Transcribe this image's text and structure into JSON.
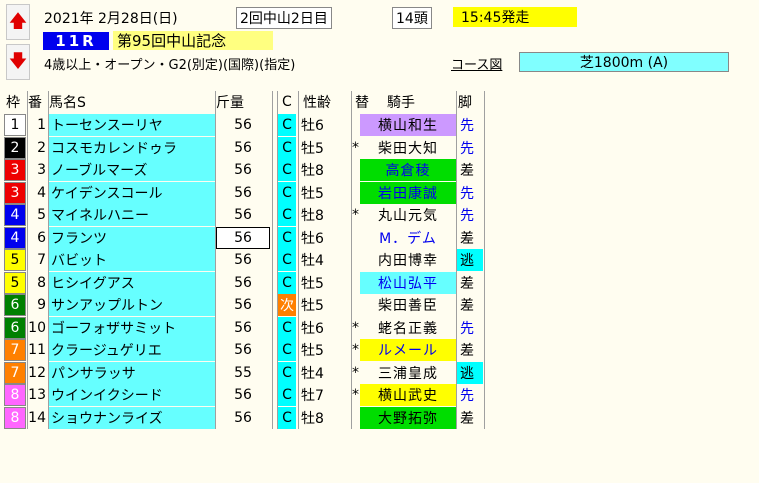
{
  "header": {
    "date": "2021年",
    "month_day": "2月28日(日)",
    "meeting": "2回中山2日目",
    "runners": "14頭",
    "post_time": "15:45発走",
    "race_no": "11R",
    "race_name": "第95回中山記念",
    "conditions": "4歳以上・オープン・G2(別定)(国際)(指定)",
    "course_link": "コース図",
    "course": "芝1800m (A)",
    "up_arrow": "🡅",
    "down_arrow": "🡇"
  },
  "columns": [
    "枠",
    "番",
    "馬名S",
    "斤量",
    "C",
    "性齢",
    "替",
    "騎手",
    "脚"
  ],
  "colors": {
    "frame": {
      "1": [
        "#ffffff",
        "#000000"
      ],
      "2": [
        "#000000",
        "#ffffff"
      ],
      "3": [
        "#ee0000",
        "#ffffff"
      ],
      "4": [
        "#0000ee",
        "#ffffff"
      ],
      "5": [
        "#ffff00",
        "#000000"
      ],
      "6": [
        "#008000",
        "#ffffff"
      ],
      "7": [
        "#ff8000",
        "#ffffff"
      ],
      "8": [
        "#ff66ff",
        "#ffffff"
      ]
    },
    "horse_cell": "#66ffff",
    "c_cell": "#00ffff",
    "next_cell": "#ff8000",
    "style_cell": "#66ffff"
  },
  "horses": [
    {
      "frame": "1",
      "num": "1",
      "name": "トーセンスーリヤ",
      "weight": "56",
      "c": "C",
      "sex_age": "牡6",
      "change": "",
      "jockey": "横山和生",
      "jockey_bg": "#cc99ff",
      "jockey_color": "#000000",
      "style": "先",
      "style_bg": "",
      "style_color": "#0000ee"
    },
    {
      "frame": "2",
      "num": "2",
      "name": "コスモカレンドゥラ",
      "weight": "56",
      "c": "C",
      "sex_age": "牡5",
      "change": "*",
      "jockey": "柴田大知",
      "jockey_bg": "",
      "jockey_color": "#000000",
      "style": "先",
      "style_bg": "",
      "style_color": "#0000ee"
    },
    {
      "frame": "3",
      "num": "3",
      "name": "ノーブルマーズ",
      "weight": "56",
      "c": "C",
      "sex_age": "牡8",
      "change": "",
      "jockey": "高倉稜",
      "jockey_bg": "#00dd00",
      "jockey_color": "#0000ee",
      "style": "差",
      "style_bg": "",
      "style_color": "#000000"
    },
    {
      "frame": "3",
      "num": "4",
      "name": "ケイデンスコール",
      "weight": "56",
      "c": "C",
      "sex_age": "牡5",
      "change": "",
      "jockey": "岩田康誠",
      "jockey_bg": "#00dd00",
      "jockey_color": "#0000ee",
      "style": "先",
      "style_bg": "",
      "style_color": "#0000ee"
    },
    {
      "frame": "4",
      "num": "5",
      "name": "マイネルハニー",
      "weight": "56",
      "c": "C",
      "sex_age": "牡8",
      "change": "*",
      "jockey": "丸山元気",
      "jockey_bg": "",
      "jockey_color": "#000000",
      "style": "先",
      "style_bg": "",
      "style_color": "#0000ee"
    },
    {
      "frame": "4",
      "num": "6",
      "name": "フランツ",
      "weight": "56",
      "c": "C",
      "sex_age": "牡6",
      "change": "",
      "jockey": "M．デム",
      "jockey_bg": "",
      "jockey_color": "#0000ee",
      "style": "差",
      "style_bg": "",
      "style_color": "#000000"
    },
    {
      "frame": "5",
      "num": "7",
      "name": "バビット",
      "weight": "56",
      "c": "C",
      "sex_age": "牡4",
      "change": "",
      "jockey": "内田博幸",
      "jockey_bg": "",
      "jockey_color": "#000000",
      "style": "逃",
      "style_bg": "#00ffff",
      "style_color": "#000000"
    },
    {
      "frame": "5",
      "num": "8",
      "name": "ヒシイグアス",
      "weight": "56",
      "c": "C",
      "sex_age": "牡5",
      "change": "",
      "jockey": "松山弘平",
      "jockey_bg": "#66ffff",
      "jockey_color": "#0000ee",
      "style": "差",
      "style_bg": "",
      "style_color": "#000000"
    },
    {
      "frame": "6",
      "num": "9",
      "name": "サンアップルトン",
      "weight": "56",
      "c": "次",
      "sex_age": "牡5",
      "change": "",
      "jockey": "柴田善臣",
      "jockey_bg": "",
      "jockey_color": "#000000",
      "style": "差",
      "style_bg": "",
      "style_color": "#000000"
    },
    {
      "frame": "6",
      "num": "10",
      "name": "ゴーフォザサミット",
      "weight": "56",
      "c": "C",
      "sex_age": "牡6",
      "change": "*",
      "jockey": "蛯名正義",
      "jockey_bg": "",
      "jockey_color": "#000000",
      "style": "先",
      "style_bg": "",
      "style_color": "#0000ee"
    },
    {
      "frame": "7",
      "num": "11",
      "name": "クラージュゲリエ",
      "weight": "56",
      "c": "C",
      "sex_age": "牡5",
      "change": "*",
      "jockey": "ルメール",
      "jockey_bg": "#ffff00",
      "jockey_color": "#0000ee",
      "style": "差",
      "style_bg": "",
      "style_color": "#000000"
    },
    {
      "frame": "7",
      "num": "12",
      "name": "パンサラッサ",
      "weight": "55",
      "c": "C",
      "sex_age": "牡4",
      "change": "*",
      "jockey": "三浦皇成",
      "jockey_bg": "",
      "jockey_color": "#000000",
      "style": "逃",
      "style_bg": "#00ffff",
      "style_color": "#000000"
    },
    {
      "frame": "8",
      "num": "13",
      "name": "ウインイクシード",
      "weight": "56",
      "c": "C",
      "sex_age": "牡7",
      "change": "*",
      "jockey": "横山武史",
      "jockey_bg": "#ffff00",
      "jockey_color": "#000000",
      "style": "先",
      "style_bg": "",
      "style_color": "#0000ee"
    },
    {
      "frame": "8",
      "num": "14",
      "name": "ショウナンライズ",
      "weight": "56",
      "c": "C",
      "sex_age": "牡8",
      "change": "",
      "jockey": "大野拓弥",
      "jockey_bg": "#00dd00",
      "jockey_color": "#000000",
      "style": "差",
      "style_bg": "",
      "style_color": "#000000"
    }
  ]
}
